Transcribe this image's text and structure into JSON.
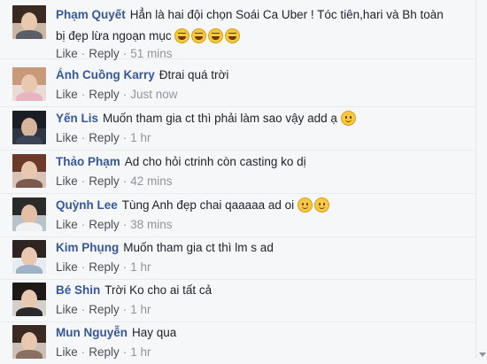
{
  "actions": {
    "like": "Like",
    "reply": "Reply",
    "separator": "·"
  },
  "comments": [
    {
      "author": "Phạm Quyết",
      "text_line1": "Hẳn là hai đội chọn Soái Ca Uber ! Tóc tiên,hari và Bh toàn",
      "text_line2": "bị đẹp lừa ngoạn mục",
      "emojis": [
        "laughing-emoji",
        "laughing-emoji",
        "laughing-emoji",
        "laughing-emoji"
      ],
      "time": "51 mins"
    },
    {
      "author": "Ánh Cuồng Karry",
      "text": "Đtrai quá trời",
      "time": "Just now"
    },
    {
      "author": "Yến Lis",
      "text": "Muốn tham gia ct thì phải làm sao vậy add ạ",
      "emojis": [
        "smile-emoji"
      ],
      "time": "1 hr"
    },
    {
      "author": "Thảo Phạm",
      "text": "Ad cho hỏi ctrinh còn casting ko dị",
      "time": "42 mins"
    },
    {
      "author": "Quỳnh Lee",
      "text": "Tùng Anh đẹp chai qaaaaa ad oi",
      "emojis": [
        "smile-emoji",
        "smile-emoji"
      ],
      "time": "38 mins"
    },
    {
      "author": "Kim Phụng",
      "text": "Muốn tham gia ct thì lm s ad",
      "time": "1 hr"
    },
    {
      "author": "Bé Shin",
      "text": "Trời Ko cho ai tất cả",
      "time": "1 hr"
    },
    {
      "author": "Mun Nguyễn",
      "text": "Hay qua",
      "time": "1 hr"
    }
  ],
  "colors": {
    "author_link": "#365899",
    "text": "#1d2129",
    "meta": "#90949c",
    "background": "#f6f7f9"
  }
}
